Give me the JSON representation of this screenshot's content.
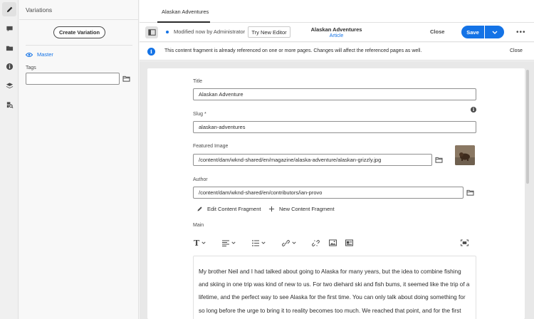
{
  "rail": {
    "items": [
      {
        "name": "edit-icon",
        "active": true
      },
      {
        "name": "comment-icon",
        "active": false
      },
      {
        "name": "folder-icon",
        "active": false
      },
      {
        "name": "info-icon",
        "active": false
      },
      {
        "name": "layers-icon",
        "active": false
      },
      {
        "name": "search-references-icon",
        "active": false
      }
    ]
  },
  "side_panel": {
    "title": "Variations",
    "create_button": "Create Variation",
    "master_label": "Master",
    "tags_label": "Tags",
    "tags_value": ""
  },
  "tab": {
    "label": "Alaskan Adventures"
  },
  "toolbar": {
    "modified_text": "Modified now by Administrator",
    "try_button": "Try New Editor",
    "doc_title": "Alaskan Adventures",
    "doc_model": "Article",
    "close_label": "Close",
    "save_label": "Save"
  },
  "banner": {
    "message": "This content fragment is already referenced on one or more pages. Changes will affect the referenced pages as well.",
    "close_label": "Close"
  },
  "form": {
    "title_label": "Title",
    "title_value": "Alaskan Adventure",
    "slug_label": "Slug *",
    "slug_value": "alaskan-adventures",
    "image_label": "Featured Image",
    "image_value": "/content/dam/wknd-shared/en/magazine/alaska-adventure/alaskan-grizzly.jpg",
    "author_label": "Author",
    "author_value": "/content/dam/wknd-shared/en/contributors/ian-provo",
    "edit_fragment": "Edit Content Fragment",
    "new_fragment": "New Content Fragment",
    "main_label": "Main",
    "main_text": "My brother Neil and I had talked about going to Alaska for many years, but the idea to combine fishing and skiing in one trip was kind of new to us. For two diehard ski and fish bums, it seemed like the trip of a lifetime, and the perfect way to see Alaska for the first time. You can only talk about doing something for so long before the urge to bring it to reality becomes too much. We reached that point, and for the first time in our lives we could make this trip happen."
  },
  "colors": {
    "accent": "#1473e6",
    "text": "#2c2c2c",
    "muted": "#4b4b4b",
    "background": "#e8e8e8"
  }
}
